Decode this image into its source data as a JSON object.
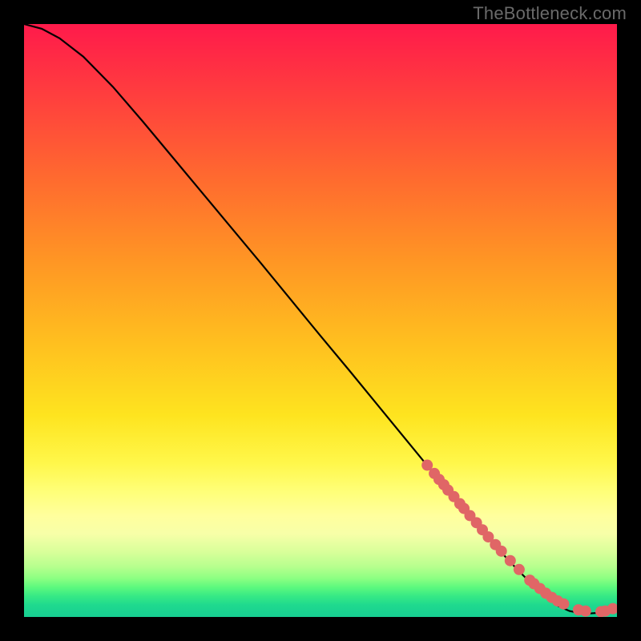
{
  "watermark": {
    "text": "TheBottleneck.com"
  },
  "colors": {
    "background": "#000000",
    "curve": "#000000",
    "dots": "#e06666",
    "gradient_top": "#ff1a4b",
    "gradient_bottom": "#17cf92"
  },
  "chart_data": {
    "type": "line",
    "title": "",
    "xlabel": "",
    "ylabel": "",
    "xlim": [
      0,
      100
    ],
    "ylim": [
      0,
      100
    ],
    "grid": false,
    "legend": false,
    "series": [
      {
        "name": "curve",
        "x": [
          0,
          3,
          6,
          10,
          15,
          20,
          25,
          30,
          35,
          40,
          45,
          50,
          55,
          60,
          65,
          70,
          73,
          76,
          79,
          81.5,
          83.5,
          85.5,
          88,
          90,
          92,
          94,
          95.5,
          97,
          98,
          99,
          100
        ],
        "y": [
          100,
          99.2,
          97.6,
          94.5,
          89.4,
          83.6,
          77.6,
          71.6,
          65.6,
          59.6,
          53.5,
          47.4,
          41.4,
          35.3,
          29.2,
          23.1,
          19.5,
          16.0,
          12.6,
          9.8,
          7.7,
          5.7,
          3.4,
          1.9,
          1.0,
          0.6,
          0.6,
          0.7,
          0.9,
          1.2,
          1.7
        ]
      },
      {
        "name": "dots",
        "x": [
          68,
          69.2,
          70,
          70.8,
          71.5,
          72.5,
          73.5,
          74.2,
          75.2,
          76.3,
          77.3,
          78.3,
          79.5,
          80.5,
          82.0,
          83.5,
          85.3,
          86.0,
          87.0,
          88.0,
          89.0,
          90.0,
          91.0,
          93.5,
          94.7,
          97.3,
          98.0,
          99.3
        ],
        "y": [
          25.6,
          24.2,
          23.2,
          22.3,
          21.4,
          20.3,
          19.1,
          18.3,
          17.1,
          15.9,
          14.7,
          13.5,
          12.2,
          11.1,
          9.5,
          8.0,
          6.2,
          5.6,
          4.8,
          4.0,
          3.3,
          2.7,
          2.2,
          1.2,
          1.0,
          0.9,
          1.0,
          1.4
        ]
      }
    ]
  }
}
